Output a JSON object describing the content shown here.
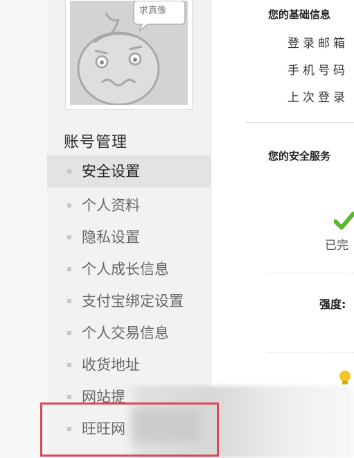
{
  "avatar": {
    "bubble_text": "求真像"
  },
  "sidebar": {
    "section_title": "账号管理",
    "items": [
      {
        "label": "安全设置",
        "active": true
      },
      {
        "label": "个人资料"
      },
      {
        "label": "隐私设置"
      },
      {
        "label": "个人成长信息"
      },
      {
        "label": "支付宝绑定设置"
      },
      {
        "label": "个人交易信息"
      },
      {
        "label": "收货地址"
      },
      {
        "label": "网站提"
      },
      {
        "label": "旺旺网"
      }
    ]
  },
  "main": {
    "basic_info_title": "您的基础信息",
    "rows": [
      {
        "label": "登录邮箱"
      },
      {
        "label": "手机号码"
      },
      {
        "label": "上次登录"
      }
    ],
    "security_title": "您的安全服务",
    "status_done": "已完",
    "strength_label": "强度:"
  },
  "colors": {
    "highlight_border": "#d94a52",
    "check_green": "#5cb531",
    "bulb_yellow": "#f3c623"
  }
}
